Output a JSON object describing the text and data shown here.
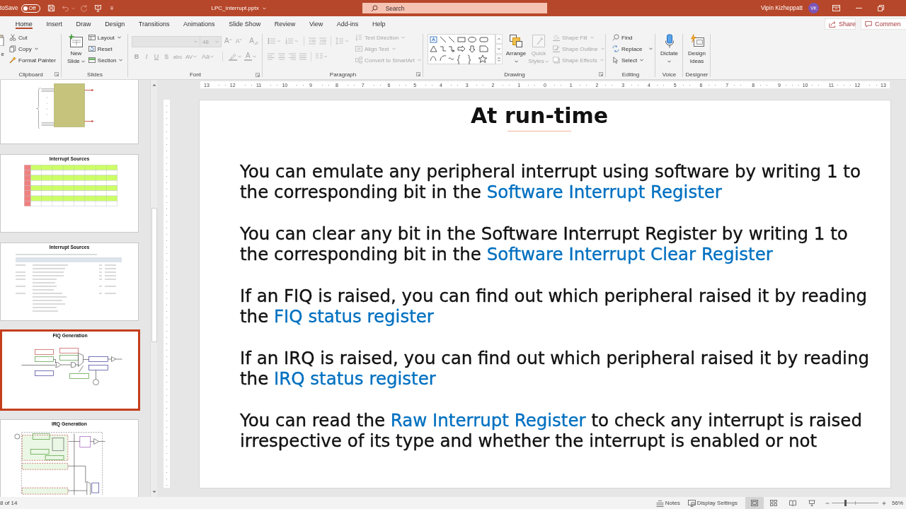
{
  "title_bar": {
    "autosave_label": "toSave",
    "autosave": {
      "label": "Off",
      "on": false
    },
    "quick_access": [
      {
        "kind": "save",
        "disabled": false,
        "dropdown": false
      },
      {
        "kind": "undo",
        "disabled": true,
        "dropdown": true
      },
      {
        "kind": "redo",
        "disabled": true,
        "dropdown": false
      },
      {
        "kind": "present",
        "disabled": false,
        "dropdown": false
      },
      {
        "kind": "customize",
        "disabled": false,
        "dropdown": false
      }
    ],
    "document_title": "LPC_Interrupt.pptx",
    "search": {
      "placeholder": "Search"
    },
    "user_name": "Vipin Kizheppatt",
    "avatar_initials": "VK"
  },
  "tabs": [
    {
      "label": "Home",
      "selected": true
    },
    {
      "label": "Insert",
      "selected": false
    },
    {
      "label": "Draw",
      "selected": false
    },
    {
      "label": "Design",
      "selected": false
    },
    {
      "label": "Transitions",
      "selected": false
    },
    {
      "label": "Animations",
      "selected": false
    },
    {
      "label": "Slide Show",
      "selected": false
    },
    {
      "label": "Review",
      "selected": false
    },
    {
      "label": "View",
      "selected": false
    },
    {
      "label": "Add-ins",
      "selected": false
    },
    {
      "label": "Help",
      "selected": false
    }
  ],
  "tab_actions": [
    {
      "kind": "share",
      "label": "Share"
    },
    {
      "kind": "comments",
      "label": "Commen"
    }
  ],
  "ribbon": {
    "clipboard": {
      "label": "Clipboard",
      "paste_label": "e",
      "buttons": [
        {
          "kind": "cut",
          "label": "Cut",
          "dropdown": false
        },
        {
          "kind": "copy",
          "label": "Copy",
          "dropdown": true
        },
        {
          "kind": "format-painter",
          "label": "Format Painter",
          "dropdown": false
        }
      ]
    },
    "slides": {
      "label": "Slides",
      "new_slide": {
        "label_lines": [
          "New",
          "Slide"
        ]
      },
      "buttons": [
        {
          "kind": "layout",
          "label": "Layout",
          "dropdown": true
        },
        {
          "kind": "reset",
          "label": "Reset",
          "dropdown": false
        },
        {
          "kind": "section",
          "label": "Section",
          "dropdown": true
        }
      ]
    },
    "font": {
      "label": "Font",
      "disabled": true,
      "font_size": "48",
      "size_buttons": [
        {
          "kind": "grow-font",
          "label": "A"
        },
        {
          "kind": "shrink-font",
          "label": "A"
        },
        {
          "kind": "clear-formatting",
          "label": "A"
        }
      ],
      "format_buttons": [
        {
          "kind": "bold",
          "label": "B",
          "dropdown": false
        },
        {
          "kind": "italic",
          "label": "I",
          "dropdown": false
        },
        {
          "kind": "underline",
          "label": "U",
          "dropdown": false
        },
        {
          "kind": "shadow",
          "label": "S",
          "dropdown": false
        },
        {
          "kind": "strikethrough",
          "label": "abc",
          "dropdown": false
        },
        {
          "kind": "character-spacing",
          "label": "AV",
          "dropdown": true
        },
        {
          "kind": "change-case",
          "label": "Aa",
          "dropdown": true
        }
      ],
      "font_color_label": "A"
    },
    "paragraph": {
      "label": "Paragraph",
      "disabled": true,
      "buttons": [
        {
          "kind": "text-direction",
          "label": "Text Direction"
        },
        {
          "kind": "align-text",
          "label": "Align Text"
        },
        {
          "kind": "convert-to-smartart",
          "label": "Convert to SmartArt"
        }
      ]
    },
    "drawing": {
      "label": "Drawing",
      "arrange": {
        "label": "Arrange",
        "disabled": false
      },
      "quick_styles": {
        "label_lines": [
          "Quick",
          "Styles"
        ],
        "disabled": true
      },
      "buttons": [
        {
          "kind": "shape-fill",
          "label": "Shape Fill",
          "disabled": true
        },
        {
          "kind": "shape-outline",
          "label": "Shape Outline",
          "disabled": true
        },
        {
          "kind": "shape-effects",
          "label": "Shape Effects",
          "disabled": true
        }
      ]
    },
    "editing": {
      "label": "Editing",
      "buttons": [
        {
          "kind": "find",
          "label": "Find",
          "dropdown": false
        },
        {
          "kind": "replace",
          "label": "Replace",
          "dropdown": true
        },
        {
          "kind": "select",
          "label": "Select",
          "dropdown": true
        }
      ]
    },
    "voice": {
      "label": "Voice",
      "dictate": {
        "label": "Dictate"
      }
    },
    "designer": {
      "label": "Designer",
      "design_ideas": {
        "label_lines": [
          "Design",
          "Ideas"
        ]
      }
    }
  },
  "thumbnails": [
    {
      "kind": "vic-diagram",
      "selected": false
    },
    {
      "kind": "color-table",
      "title": "Interrupt Sources",
      "selected": false
    },
    {
      "kind": "text-table",
      "title": "Interrupt Sources",
      "selected": false
    },
    {
      "kind": "fiq-diagram",
      "title": "FIQ Generation",
      "selected": true
    },
    {
      "kind": "irq-diagram",
      "title": "IRQ Generation",
      "selected": false
    }
  ],
  "ruler": [
    "13",
    "12",
    "11",
    "10",
    "9",
    "8",
    "7",
    "6",
    "5",
    "4",
    "3",
    "2",
    "1",
    "0",
    "1",
    "2",
    "3",
    "4",
    "5",
    "6",
    "7",
    "8",
    "9",
    "10",
    "11",
    "12",
    "13"
  ],
  "slide": {
    "title": "At run-time",
    "paragraphs": [
      {
        "runs": [
          {
            "text": "You can emulate any peripheral interrupt using software by writing 1 to the corresponding bit in the ",
            "highlight": false
          },
          {
            "text": "Software Interrupt Register",
            "highlight": true
          }
        ]
      },
      {
        "runs": [
          {
            "text": "You can clear any bit in the Software Interrupt Register by writing 1 to the corresponding bit in the ",
            "highlight": false
          },
          {
            "text": "Software Interrupt Clear Register",
            "highlight": true
          }
        ]
      },
      {
        "runs": [
          {
            "text": "If an FIQ is raised, you can find out which peripheral raised it by reading the ",
            "highlight": false
          },
          {
            "text": "FIQ status register",
            "highlight": true
          }
        ]
      },
      {
        "runs": [
          {
            "text": "If an IRQ is raised, you can find out which peripheral raised it by reading the ",
            "highlight": false
          },
          {
            "text": "IRQ status register",
            "highlight": true
          }
        ]
      },
      {
        "runs": [
          {
            "text": "You can read the ",
            "highlight": false
          },
          {
            "text": "Raw Interrupt Register",
            "highlight": true
          },
          {
            "text": " to check any interrupt is raised irrespective of its type and whether the interrupt is enabled or not",
            "highlight": false
          }
        ]
      }
    ]
  },
  "status_bar": {
    "slide_counter": "8 of 14",
    "buttons": [
      {
        "kind": "notes",
        "label": "Notes"
      },
      {
        "kind": "display-settings",
        "label": "Display Settings"
      }
    ],
    "views": [
      {
        "kind": "normal",
        "selected": true
      },
      {
        "kind": "slide-sorter",
        "selected": false
      },
      {
        "kind": "reading",
        "selected": false
      },
      {
        "kind": "slideshow",
        "selected": false
      }
    ],
    "zoom": {
      "level": 0.29,
      "label": "56%"
    }
  }
}
